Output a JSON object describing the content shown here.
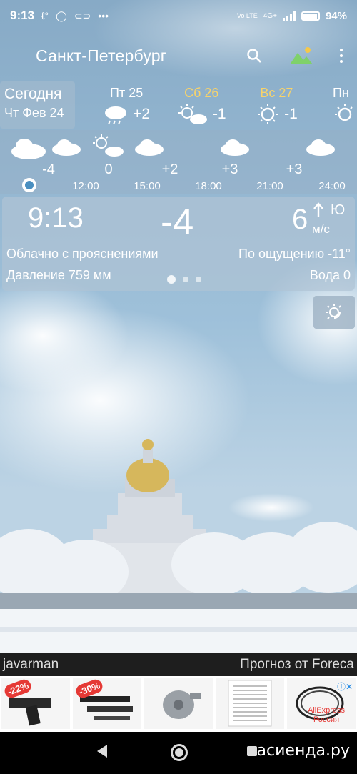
{
  "status_bar": {
    "time": "9:13",
    "icons": [
      "temperature-icon",
      "whatsapp-icon",
      "link-icon",
      "more-icon"
    ],
    "network": "4G+",
    "volte": "Vo LTE",
    "battery": "94%"
  },
  "app_bar": {
    "city": "Санкт-Петербург",
    "icons": [
      "search-icon",
      "landscape-icon",
      "overflow-menu-icon"
    ]
  },
  "days": {
    "today": {
      "label": "Сегодня",
      "date": "Чт Фев 24"
    },
    "items": [
      {
        "name": "Пт 25",
        "temp": "+2",
        "icon": "rain-cloud-icon",
        "weekend": false
      },
      {
        "name": "Сб 26",
        "temp": "-1",
        "icon": "sun-cloud-icon",
        "weekend": true
      },
      {
        "name": "Вс 27",
        "temp": "-1",
        "icon": "sun-icon",
        "weekend": true
      },
      {
        "name": "Пн",
        "temp": "",
        "icon": "sun-icon",
        "weekend": false
      }
    ]
  },
  "hourly": {
    "temps": [
      "-4",
      "0",
      "+2",
      "+3",
      "+3"
    ],
    "times": [
      "12:00",
      "15:00",
      "18:00",
      "21:00",
      "24:00"
    ]
  },
  "current": {
    "time": "9:13",
    "temp": "-4",
    "wind_speed": "6",
    "wind_dir": "Ю",
    "wind_unit": "м/с",
    "condition": "Облачно с прояснениями",
    "feels_like": "По ощущению -11°",
    "pressure": "Давление 759 мм",
    "water": "Вода 0"
  },
  "footer": {
    "author": "javarman",
    "provider": "Прогноз от Foreca"
  },
  "ads": [
    {
      "badge": "-22%",
      "label": ""
    },
    {
      "badge": "-30%",
      "label": ""
    },
    {
      "badge": "",
      "label": ""
    },
    {
      "badge": "",
      "label": ""
    },
    {
      "badge": "",
      "label": "AliExpress Россия"
    }
  ],
  "watermark": "асиенда.ру",
  "colors": {
    "weekend": "#f7d36b",
    "sky": "#8fb3cf",
    "accent_dot": "#4a8fc0"
  }
}
